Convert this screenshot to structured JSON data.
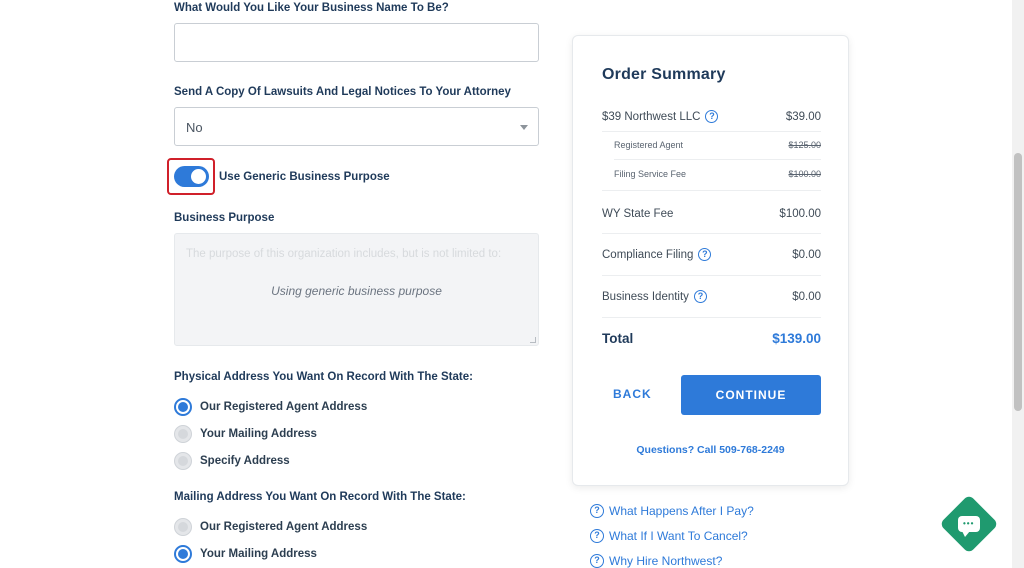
{
  "form": {
    "business_name_label": "What Would You Like Your Business Name To Be?",
    "business_name_value": "",
    "lawsuits_label": "Send A Copy Of Lawsuits And Legal Notices To Your Attorney",
    "lawsuits_value": "No",
    "generic_purpose_label": "Use Generic Business Purpose",
    "generic_purpose_on": true,
    "business_purpose_label": "Business Purpose",
    "business_purpose_placeholder": "The purpose of this organization includes, but is not limited to:",
    "business_purpose_overlay": "Using generic business purpose",
    "physical_address_label": "Physical Address You Want On Record With The State:",
    "physical_options": [
      {
        "label": "Our Registered Agent Address",
        "checked": true
      },
      {
        "label": "Your Mailing Address",
        "checked": false
      },
      {
        "label": "Specify Address",
        "checked": false
      }
    ],
    "mailing_address_label": "Mailing Address You Want On Record With The State:",
    "mailing_options": [
      {
        "label": "Our Registered Agent Address",
        "checked": false
      },
      {
        "label": "Your Mailing Address",
        "checked": true
      }
    ]
  },
  "summary": {
    "title": "Order Summary",
    "package_label": "$39 Northwest LLC",
    "package_price": "$39.00",
    "registered_agent_label": "Registered Agent",
    "registered_agent_price": "$125.00",
    "filing_fee_label": "Filing Service Fee",
    "filing_fee_price": "$100.00",
    "state_fee_label": "WY State Fee",
    "state_fee_price": "$100.00",
    "compliance_label": "Compliance Filing",
    "compliance_price": "$0.00",
    "identity_label": "Business Identity",
    "identity_price": "$0.00",
    "total_label": "Total",
    "total_price": "$139.00",
    "back_label": "BACK",
    "continue_label": "CONTINUE",
    "questions_text": "Questions? Call 509-768-2249"
  },
  "faq": [
    "What Happens After I Pay?",
    "What If I Want To Cancel?",
    "Why Hire Northwest?"
  ],
  "colors": {
    "accent": "#2e7ad9",
    "heading": "#1f3a5a",
    "chat": "#1f9a6f",
    "highlight": "#d0202a"
  },
  "icons": {
    "help": "question-circle-icon",
    "chat": "chat-bubble-icon",
    "select_caret": "caret-down-icon"
  }
}
